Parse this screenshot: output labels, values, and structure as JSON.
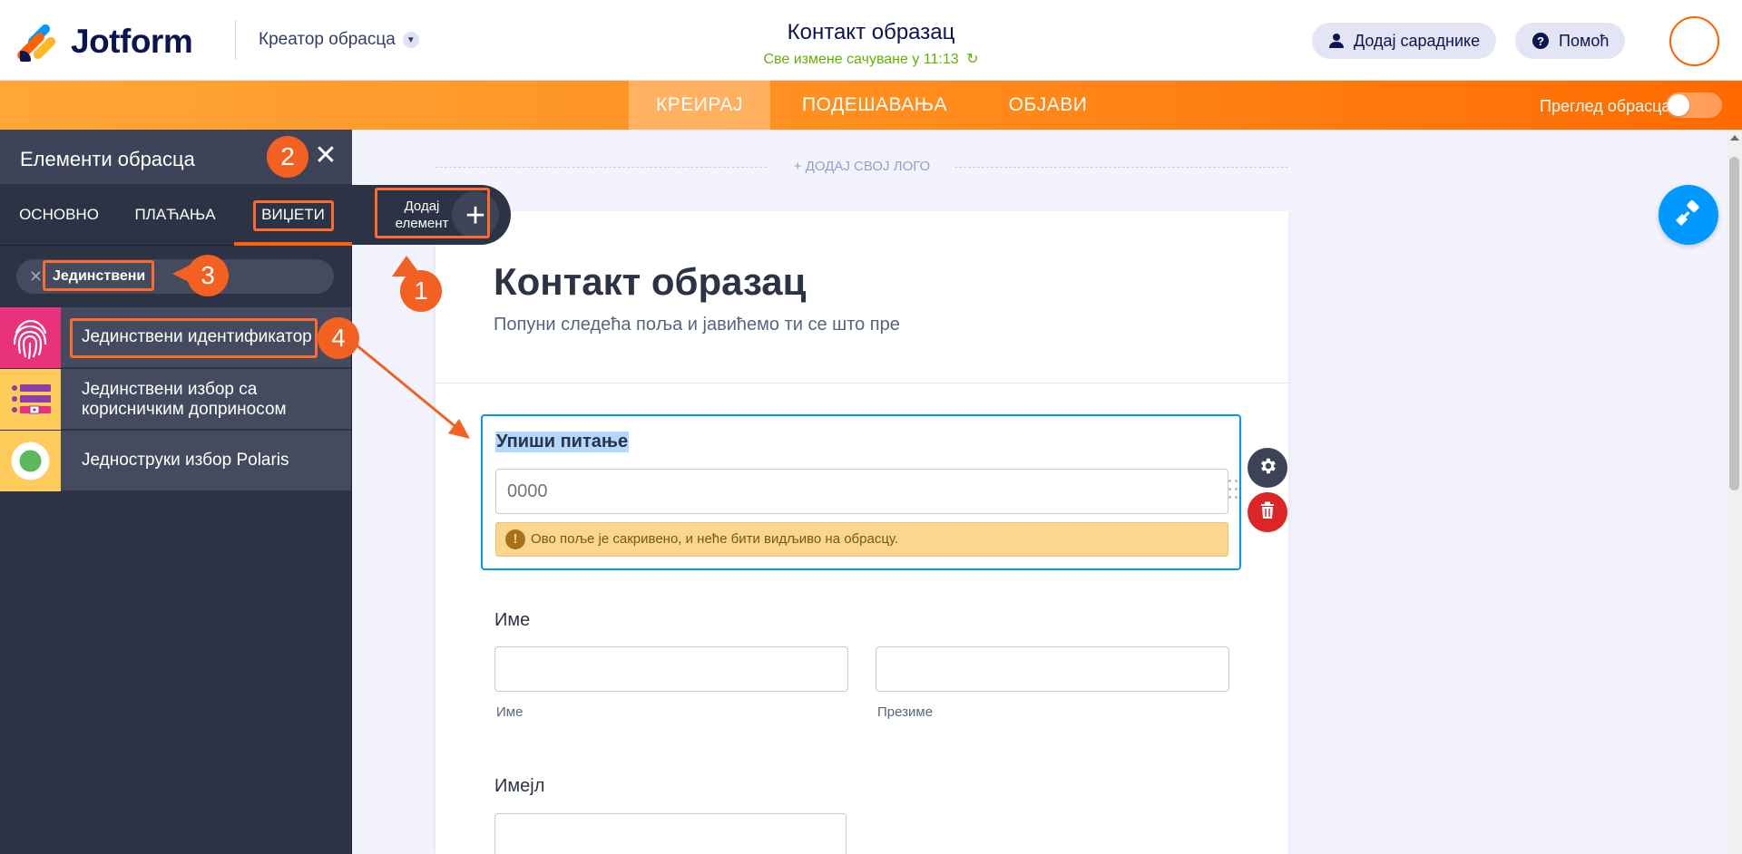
{
  "header": {
    "brand": "Jotform",
    "creator_label": "Креатор обрасца",
    "form_title": "Контакт образац",
    "saved_status": "Све измене сачуване у 11:13",
    "add_collaborators": "Додај сараднике",
    "help": "Помоћ"
  },
  "nav": {
    "tabs": [
      {
        "label": "КРЕИРАЈ",
        "active": true
      },
      {
        "label": "ПОДЕШАВАЊА",
        "active": false
      },
      {
        "label": "ОБЈАВИ",
        "active": false
      }
    ],
    "preview_label": "Преглед обрасца",
    "preview_on": false
  },
  "panel": {
    "title": "Елементи обрасца",
    "tabs": [
      {
        "label": "ОСНОВНО",
        "active": false
      },
      {
        "label": "ПЛАЋАЊА",
        "active": false
      },
      {
        "label": "ВИЏЕТИ",
        "active": true
      }
    ],
    "search_value": "Јединствени",
    "results": [
      {
        "label": "Јединствени идентификатор",
        "icon": "fingerprint-icon"
      },
      {
        "label": "Јединствени избор са корисничким доприносом",
        "icon": "list-choice-icon"
      },
      {
        "label": "Једноструки избор Polaris",
        "icon": "radio-green-icon"
      }
    ]
  },
  "canvas": {
    "add_logo": "+ ДОДАЈ СВОЈ ЛОГО",
    "add_element": "Додај елемент",
    "form_heading": "Контакт образац",
    "form_subheading": "Попуни следећа поља и јавићемо ти се што пре",
    "selected_field": {
      "question": "Упиши питање",
      "placeholder": "0000",
      "warning": "Ово поље је сакривено, и неће бити видљиво на обрасцу."
    },
    "name_field": {
      "label": "Име",
      "first_sub": "Име",
      "last_sub": "Презиме"
    },
    "email_field": {
      "label": "Имејл"
    }
  },
  "annotations": [
    "1",
    "2",
    "3",
    "4"
  ],
  "colors": {
    "accent_orange": "#ff6100",
    "selection_blue": "#0099ff",
    "panel_dark": "#2c3345",
    "saved_green": "#64b200",
    "annotation": "#f26122"
  }
}
